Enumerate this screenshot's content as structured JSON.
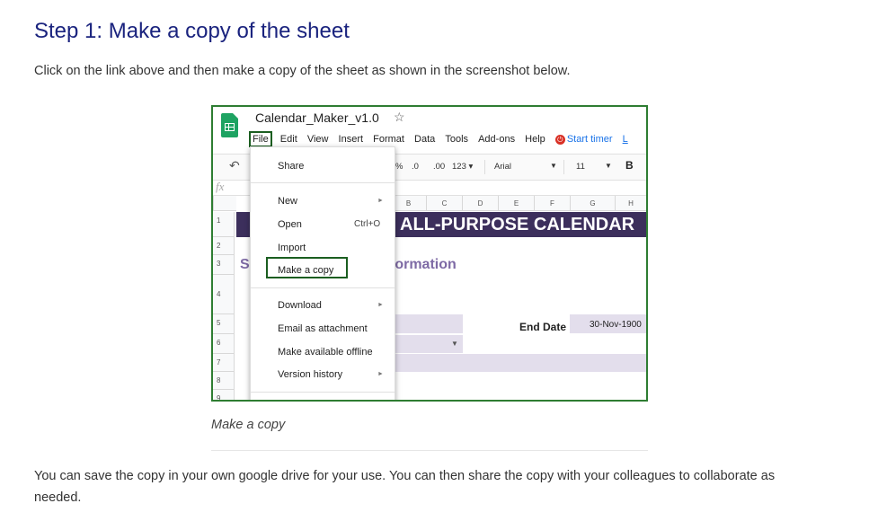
{
  "article": {
    "heading": "Step 1: Make a copy of the sheet",
    "intro": "Click on the link above and then make a copy of the sheet as shown in the screenshot below.",
    "caption": "Make a copy",
    "outro": "You can save the copy in your own google drive for your use. You can then share the copy with your colleagues to collaborate as needed."
  },
  "screenshot": {
    "doc_title": "Calendar_Maker_v1.0",
    "menu": [
      "File",
      "Edit",
      "View",
      "Insert",
      "Format",
      "Data",
      "Tools",
      "Add-ons",
      "Help"
    ],
    "start_timer": "Start timer",
    "trailing_menu": "L",
    "toolbar": {
      "percent": "%",
      "dec_less": ".0",
      "dec_more": ".00",
      "number_format": "123",
      "font": "Arial",
      "font_size": "11",
      "bold": "B"
    },
    "fx": "fx",
    "columns": [
      "B",
      "C",
      "D",
      "E",
      "F",
      "G",
      "H"
    ],
    "rows": [
      "1",
      "2",
      "3",
      "4",
      "5",
      "6",
      "7",
      "8",
      "9"
    ],
    "banner": "ALL-PURPOSE CALENDAR",
    "section_title_fragment": "formation",
    "section_title_initial": "S",
    "end_date_label": "End Date",
    "end_date_value": "30-Nov-1900",
    "file_menu": {
      "share": "Share",
      "new": "New",
      "open": "Open",
      "open_shortcut": "Ctrl+O",
      "import": "Import",
      "make_copy": "Make a copy",
      "download": "Download",
      "email": "Email as attachment",
      "offline": "Make available offline",
      "version_history": "Version history"
    }
  }
}
